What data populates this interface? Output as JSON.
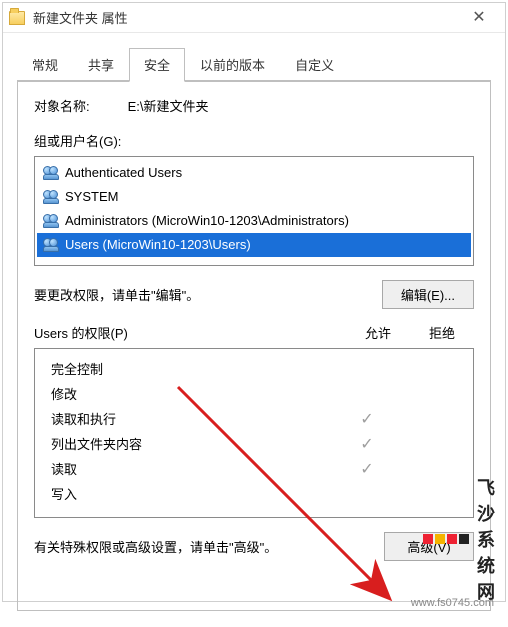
{
  "title": "新建文件夹 属性",
  "tabs": {
    "general": "常规",
    "share": "共享",
    "security": "安全",
    "prev": "以前的版本",
    "custom": "自定义"
  },
  "object": {
    "label": "对象名称:",
    "path": "E:\\新建文件夹"
  },
  "groups": {
    "label": "组或用户名(G):",
    "items": [
      {
        "text": "Authenticated Users",
        "selected": false
      },
      {
        "text": "SYSTEM",
        "selected": false
      },
      {
        "text": "Administrators (MicroWin10-1203\\Administrators)",
        "selected": false
      },
      {
        "text": "Users (MicroWin10-1203\\Users)",
        "selected": true
      }
    ]
  },
  "edit": {
    "hint": "要更改权限，请单击\"编辑\"。",
    "button": "编辑(E)..."
  },
  "perm": {
    "header_name": "Users 的权限(P)",
    "col_allow": "允许",
    "col_deny": "拒绝",
    "rows": [
      {
        "name": "完全控制",
        "allow": false,
        "deny": false
      },
      {
        "name": "修改",
        "allow": false,
        "deny": false
      },
      {
        "name": "读取和执行",
        "allow": true,
        "deny": false
      },
      {
        "name": "列出文件夹内容",
        "allow": true,
        "deny": false
      },
      {
        "name": "读取",
        "allow": true,
        "deny": false
      },
      {
        "name": "写入",
        "allow": false,
        "deny": false
      }
    ]
  },
  "adv": {
    "hint": "有关特殊权限或高级设置，请单击\"高级\"。",
    "button": "高级(V)"
  },
  "watermark": {
    "brand": "飞沙系统网",
    "url": "www.fs0745.com"
  }
}
